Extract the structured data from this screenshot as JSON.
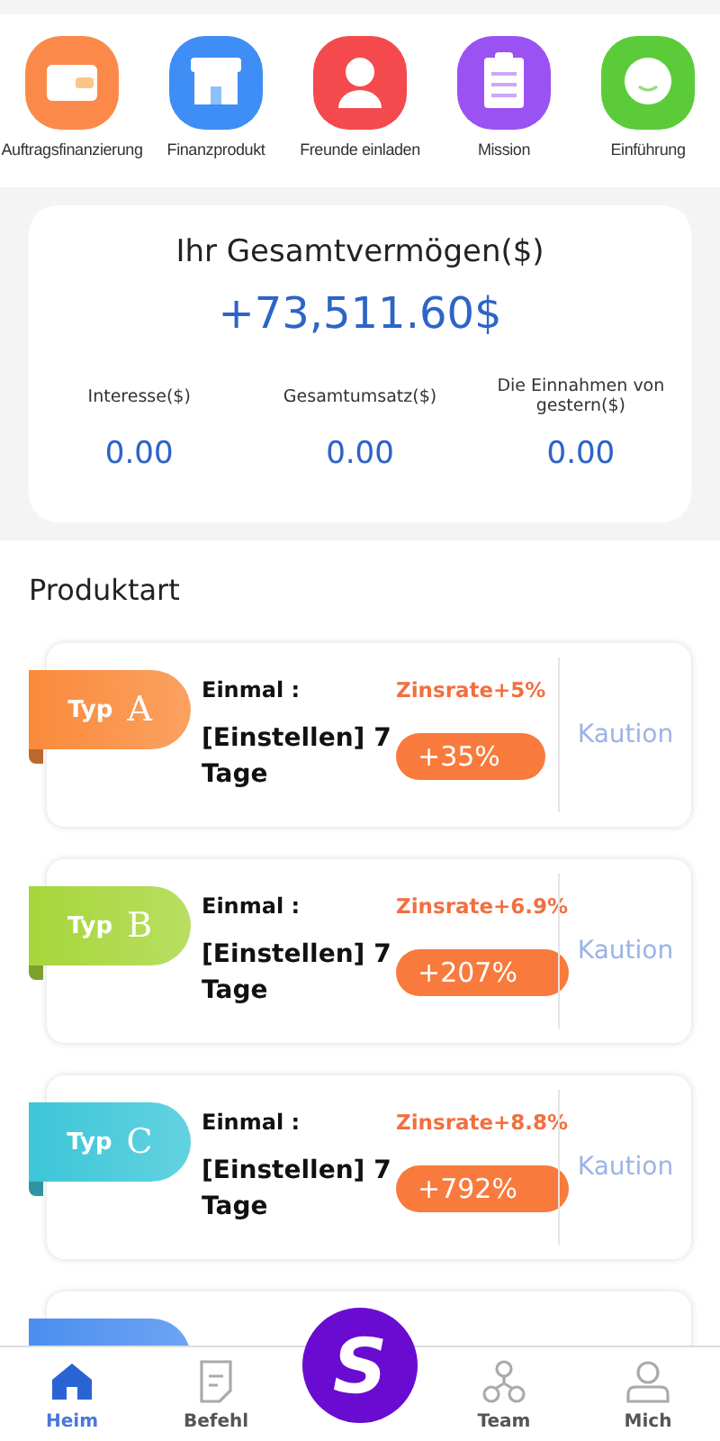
{
  "shortcuts": [
    {
      "label": "Auftragsfinanzierung",
      "kind": "wallet",
      "color": "#fb8a4a"
    },
    {
      "label": "Finanzprodukt",
      "kind": "shop",
      "color": "#3f8ef5"
    },
    {
      "label": "Freunde einladen",
      "kind": "person",
      "color": "#f44a4e"
    },
    {
      "label": "Mission",
      "kind": "clipboard",
      "color": "#9b52f2"
    },
    {
      "label": "Einführung",
      "kind": "smile",
      "color": "#5ccb3a"
    }
  ],
  "assets": {
    "title": "Ihr Gesamtvermögen($)",
    "total": "+73,511.60$",
    "stats": [
      {
        "label": "Interesse($)",
        "value": "0.00"
      },
      {
        "label": "Gesamtumsatz($)",
        "value": "0.00"
      },
      {
        "label": "Die Einnahmen von gestern($)",
        "value": "0.00"
      }
    ]
  },
  "section_title": "Produktart",
  "products": [
    {
      "type_label": "Typ",
      "letter": "A",
      "color": "#fa8a3a",
      "once_label": "Einmal :",
      "rate_label": "Zinsrate",
      "rate": "+5%",
      "term": "[Einstellen] 7 Tage",
      "return": "+35%",
      "action": "Kaution"
    },
    {
      "type_label": "Typ",
      "letter": "B",
      "color": "#a6d63a",
      "once_label": "Einmal :",
      "rate_label": "Zinsrate",
      "rate": "+6.9%",
      "term": "[Einstellen] 7 Tage",
      "return": "+207%",
      "action": "Kaution"
    },
    {
      "type_label": "Typ",
      "letter": "C",
      "color": "#3cc6d8",
      "once_label": "Einmal :",
      "rate_label": "Zinsrate",
      "rate": "+8.8%",
      "term": "[Einstellen] 7 Tage",
      "return": "+792%",
      "action": "Kaution"
    },
    {
      "kind": "partial",
      "color": "#4a8ef0"
    }
  ],
  "nav": [
    {
      "label": "Heim",
      "kind": "home",
      "selected": true
    },
    {
      "label": "Befehl",
      "kind": "doc",
      "selected": false
    },
    {
      "kind": "logo",
      "label": "S"
    },
    {
      "label": "Team",
      "kind": "team",
      "selected": false
    },
    {
      "label": "Mich",
      "kind": "user",
      "selected": false
    }
  ]
}
